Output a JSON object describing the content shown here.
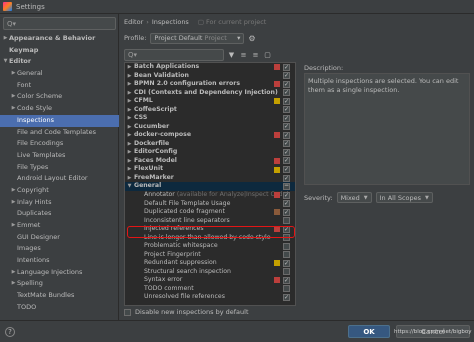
{
  "window": {
    "title": "Settings"
  },
  "sidebar": {
    "search_placeholder": "Q▾",
    "items": [
      {
        "label": "Appearance & Behavior",
        "arrow": "▶",
        "indent": 0,
        "bold": true
      },
      {
        "label": "Keymap",
        "arrow": "",
        "indent": 0,
        "bold": true
      },
      {
        "label": "Editor",
        "arrow": "▼",
        "indent": 0,
        "bold": true
      },
      {
        "label": "General",
        "arrow": "▶",
        "indent": 1
      },
      {
        "label": "Font",
        "arrow": "",
        "indent": 1
      },
      {
        "label": "Color Scheme",
        "arrow": "▶",
        "indent": 1
      },
      {
        "label": "Code Style",
        "arrow": "▶",
        "indent": 1
      },
      {
        "label": "Inspections",
        "arrow": "",
        "indent": 1,
        "selected": true
      },
      {
        "label": "File and Code Templates",
        "arrow": "",
        "indent": 1
      },
      {
        "label": "File Encodings",
        "arrow": "",
        "indent": 1
      },
      {
        "label": "Live Templates",
        "arrow": "",
        "indent": 1
      },
      {
        "label": "File Types",
        "arrow": "",
        "indent": 1
      },
      {
        "label": "Android Layout Editor",
        "arrow": "",
        "indent": 1
      },
      {
        "label": "Copyright",
        "arrow": "▶",
        "indent": 1
      },
      {
        "label": "Inlay Hints",
        "arrow": "▶",
        "indent": 1
      },
      {
        "label": "Duplicates",
        "arrow": "",
        "indent": 1
      },
      {
        "label": "Emmet",
        "arrow": "▶",
        "indent": 1
      },
      {
        "label": "GUI Designer",
        "arrow": "",
        "indent": 1
      },
      {
        "label": "Images",
        "arrow": "",
        "indent": 1
      },
      {
        "label": "Intentions",
        "arrow": "",
        "indent": 1
      },
      {
        "label": "Language Injections",
        "arrow": "▶",
        "indent": 1
      },
      {
        "label": "Spelling",
        "arrow": "▶",
        "indent": 1
      },
      {
        "label": "TextMate Bundles",
        "arrow": "",
        "indent": 1
      },
      {
        "label": "TODO",
        "arrow": "",
        "indent": 1
      }
    ]
  },
  "breadcrumb": {
    "parent": "Editor",
    "sep": "›",
    "current": "Inspections",
    "scope": "For current project"
  },
  "profile": {
    "label": "Profile:",
    "value": "Project Default",
    "sub": "Project",
    "chevron": "▾"
  },
  "toolbar": {
    "search_placeholder": "Q▾",
    "filter_icon": "▼",
    "expand_icon": "≡",
    "collapse_icon": "≡",
    "reset_icon": "▢"
  },
  "inspections": [
    {
      "label": "Batch Applications",
      "arrow": "▶",
      "bold": true,
      "sev": "red",
      "cb": "✓"
    },
    {
      "label": "Bean Validation",
      "arrow": "▶",
      "bold": true,
      "sev": "",
      "cb": "✓"
    },
    {
      "label": "BPMN 2.0 configuration errors",
      "arrow": "▶",
      "bold": true,
      "sev": "red",
      "cb": "✓"
    },
    {
      "label": "CDI (Contexts and Dependency Injection)",
      "arrow": "▶",
      "bold": true,
      "sev": "",
      "cb": "✓"
    },
    {
      "label": "CFML",
      "arrow": "▶",
      "bold": true,
      "sev": "yellow",
      "cb": "✓"
    },
    {
      "label": "CoffeeScript",
      "arrow": "▶",
      "bold": true,
      "sev": "",
      "cb": "✓"
    },
    {
      "label": "CSS",
      "arrow": "▶",
      "bold": true,
      "sev": "",
      "cb": "✓"
    },
    {
      "label": "Cucumber",
      "arrow": "▶",
      "bold": true,
      "sev": "",
      "cb": "✓"
    },
    {
      "label": "docker-compose",
      "arrow": "▶",
      "bold": true,
      "sev": "red",
      "cb": "✓"
    },
    {
      "label": "Dockerfile",
      "arrow": "▶",
      "bold": true,
      "sev": "",
      "cb": "✓"
    },
    {
      "label": "EditorConfig",
      "arrow": "▶",
      "bold": true,
      "sev": "",
      "cb": "✓"
    },
    {
      "label": "Faces Model",
      "arrow": "▶",
      "bold": true,
      "sev": "red",
      "cb": "✓"
    },
    {
      "label": "FlexUnit",
      "arrow": "▶",
      "bold": true,
      "sev": "yellow",
      "cb": "✓"
    },
    {
      "label": "FreeMarker",
      "arrow": "▶",
      "bold": true,
      "sev": "",
      "cb": "✓"
    },
    {
      "label": "General",
      "arrow": "▼",
      "bold": true,
      "sev": "",
      "cb": "−",
      "selected": true
    },
    {
      "label": "Annotator",
      "muted": "(available for Analyze|Inspect Code)",
      "child": true,
      "sev": "red",
      "cb": "✓"
    },
    {
      "label": "Default File Template Usage",
      "child": true,
      "sev": "",
      "cb": "✓"
    },
    {
      "label": "Duplicated code fragment",
      "child": true,
      "sev": "brown",
      "cb": "✓"
    },
    {
      "label": "Inconsistent line separators",
      "child": true,
      "sev": "",
      "cb": ""
    },
    {
      "label": "Injected references",
      "child": true,
      "sev": "red",
      "cb": "✓"
    },
    {
      "label": "Line is longer than allowed by code style",
      "child": true,
      "sev": "",
      "cb": ""
    },
    {
      "label": "Problematic whitespace",
      "child": true,
      "sev": "",
      "cb": ""
    },
    {
      "label": "Project Fingerprint",
      "child": true,
      "sev": "",
      "cb": ""
    },
    {
      "label": "Redundant suppression",
      "child": true,
      "sev": "yellow",
      "cb": "✓"
    },
    {
      "label": "Structural search inspection",
      "child": true,
      "sev": "",
      "cb": ""
    },
    {
      "label": "Syntax error",
      "child": true,
      "sev": "red",
      "cb": "✓"
    },
    {
      "label": "TODO comment",
      "child": true,
      "sev": "",
      "cb": ""
    },
    {
      "label": "Unresolved file references",
      "child": true,
      "sev": "",
      "cb": "✓"
    }
  ],
  "bottom_checkbox": {
    "label": "Disable new inspections by default"
  },
  "description": {
    "label": "Description:",
    "text": "Multiple inspections are selected. You can edit them as a single inspection."
  },
  "severity": {
    "label": "Severity:",
    "value": "Mixed",
    "scope": "In All Scopes"
  },
  "footer": {
    "help": "?",
    "ok": "OK",
    "cancel": "Cancel",
    "watermark": "https://blog.csdn.net/bigboy"
  },
  "colors": {
    "red": "#bc3f3c",
    "yellow": "#c4a000",
    "brown": "#8a5a3a",
    "selected": "#4b6eaf",
    "highlight": "#e41515"
  }
}
